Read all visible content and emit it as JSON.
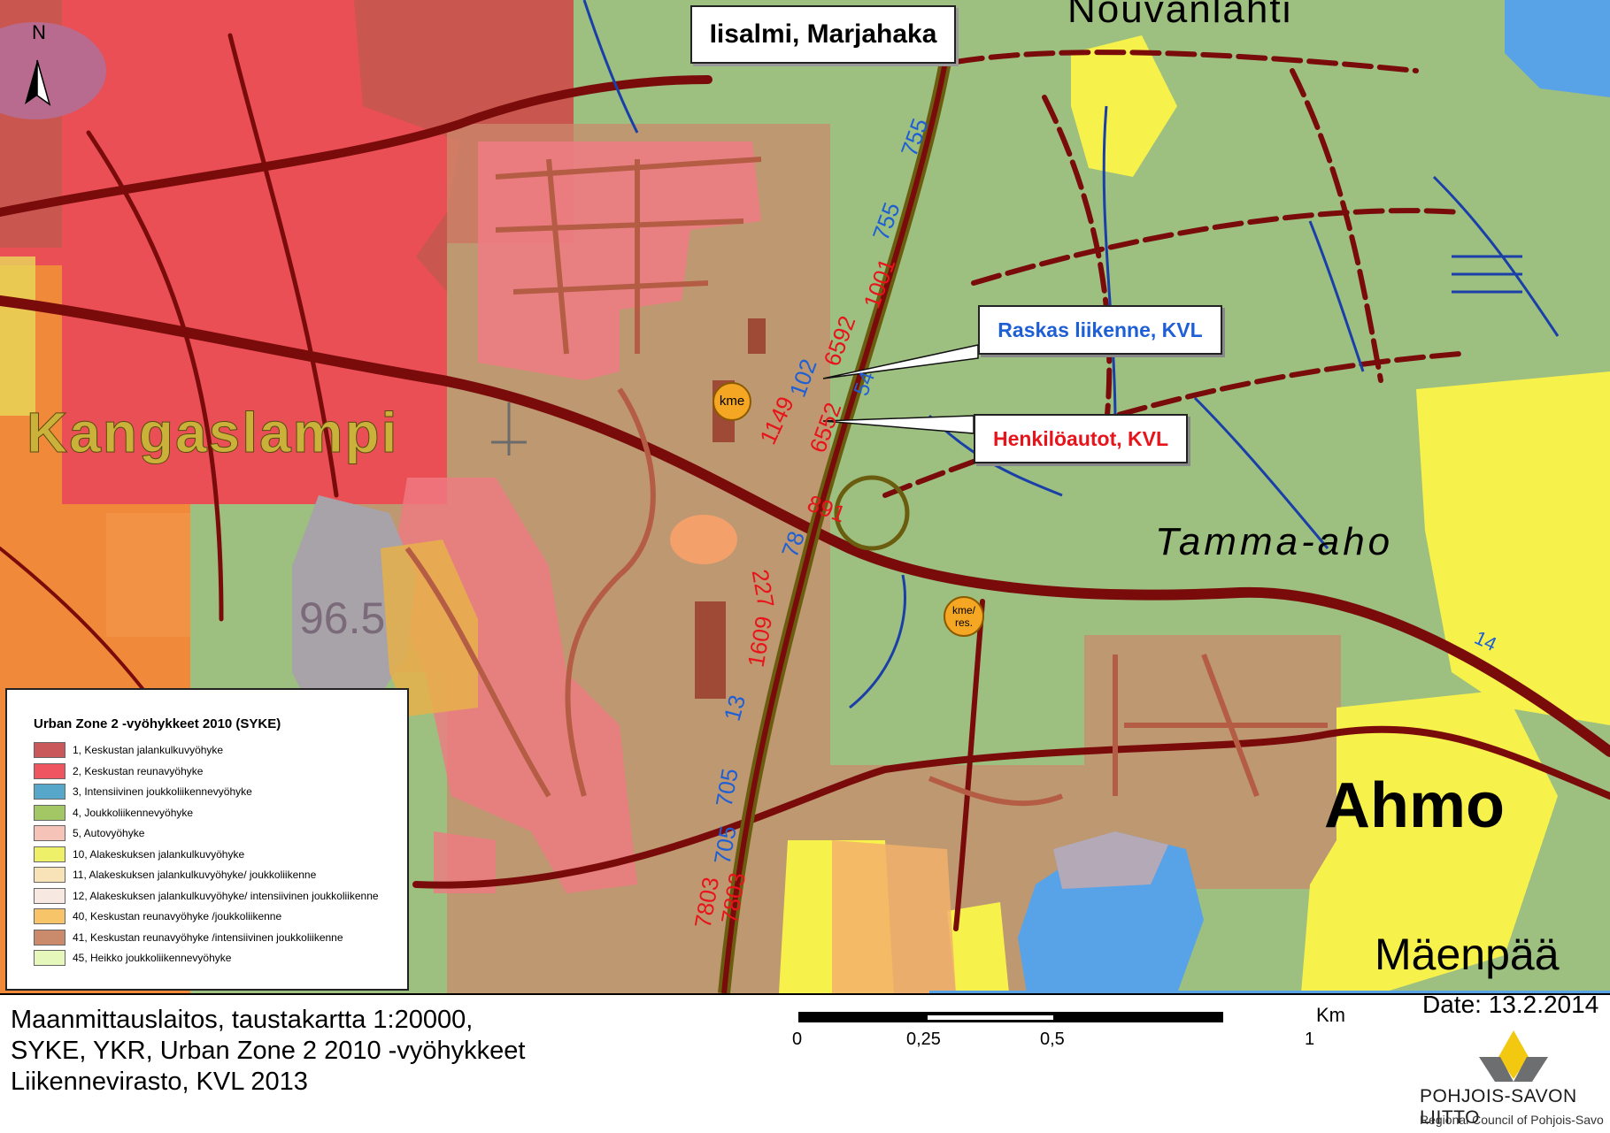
{
  "map": {
    "title": "Iisalmi, Marjahaka",
    "north_arrow": "N",
    "place_names": {
      "kangaslampi": "Kangaslampi",
      "nouvanlahti": "Nouvanlahti",
      "tamma_aho": "Tamma-aho",
      "ahmo": "Ahmo",
      "maenpaa": "Mäenpää",
      "elevation": "96.5"
    },
    "callouts": {
      "heavy": "Raskas liikenne, KVL",
      "cars": "Henkilöautot, KVL"
    },
    "markers": {
      "kme": "kme",
      "kme_res": "kme/ res."
    },
    "traffic_labels": {
      "heavy_755_top": "755",
      "heavy_755_mid": "755",
      "heavy_102": "102",
      "heavy_54": "54",
      "heavy_78": "78",
      "heavy_13": "13",
      "heavy_705_a": "705",
      "heavy_705_b": "705",
      "heavy_14": "14",
      "cars_1001": "1001",
      "cars_6592": "6592",
      "cars_1149": "1149",
      "cars_6552": "6552",
      "cars_891": "891",
      "cars_227": "227",
      "cars_1609": "1609",
      "cars_7803_a": "7803",
      "cars_7803_b": "7803"
    },
    "colors": {
      "green": "#9dbf7f",
      "zone1": "#c9585a",
      "zone2": "#ef4e56",
      "zone3": "#56a7c9",
      "zone4": "#9cc25f",
      "zone5": "#f5c2b7",
      "zone10": "#f0f060",
      "zone11": "#f8e1b4",
      "zone12": "#f5e6de",
      "zone40": "#f7c46a",
      "zone41": "#c98b6b",
      "zone45": "#e5f5b7",
      "water": "#58a2e8",
      "road": "#7a0b0b",
      "stream": "#1a3fa8",
      "heavy_text": "#1f5fd6",
      "cars_text": "#e8141b",
      "marker": "#f5a623"
    }
  },
  "legend": {
    "title": "Urban Zone 2 -vyöhykkeet 2010 (SYKE)",
    "items": [
      {
        "label": "1, Keskustan jalankulkuvyöhyke",
        "color": "#c9585a"
      },
      {
        "label": "2, Keskustan reunavyöhyke",
        "color": "#ef5560"
      },
      {
        "label": "3, Intensiivinen joukkoliikennevyöhyke",
        "color": "#56a7c9"
      },
      {
        "label": "4, Joukkoliikennevyöhyke",
        "color": "#a4c766"
      },
      {
        "label": "5, Autovyöhyke",
        "color": "#f5c3b8"
      },
      {
        "label": "10, Alakeskuksen jalankulkuvyöhyke",
        "color": "#eef06a"
      },
      {
        "label": "11, Alakeskuksen jalankulkuvyöhyke/ joukkoliikenne",
        "color": "#f8e2b8"
      },
      {
        "label": "12, Alakeskuksen jalankulkuvyöhyke/ intensiivinen joukkoliikenne",
        "color": "#f7e8e2"
      },
      {
        "label": "40, Keskustan reunavyöhyke /joukkoliikenne",
        "color": "#f7c46a"
      },
      {
        "label": "41, Keskustan reunavyöhyke /intensiivinen joukkoliikenne",
        "color": "#c98b6b"
      },
      {
        "label": "45, Heikko joukkoliikennevyöhyke",
        "color": "#e6f7bb"
      }
    ]
  },
  "footer": {
    "source_line1": "Maanmittauslaitos, taustakartta 1:20000,",
    "source_line2": "SYKE, YKR, Urban Zone 2 2010 -vyöhykkeet",
    "source_line3": "Liikennevirasto, KVL 2013",
    "date": "Date: 13.2.2014",
    "scale_unit": "Km",
    "scale_ticks": [
      "0",
      "0,25",
      "0,5",
      "1"
    ],
    "organization": "POHJOIS-SAVON LIITTO",
    "organization_sub": "Regional Council of Pohjois-Savo"
  }
}
